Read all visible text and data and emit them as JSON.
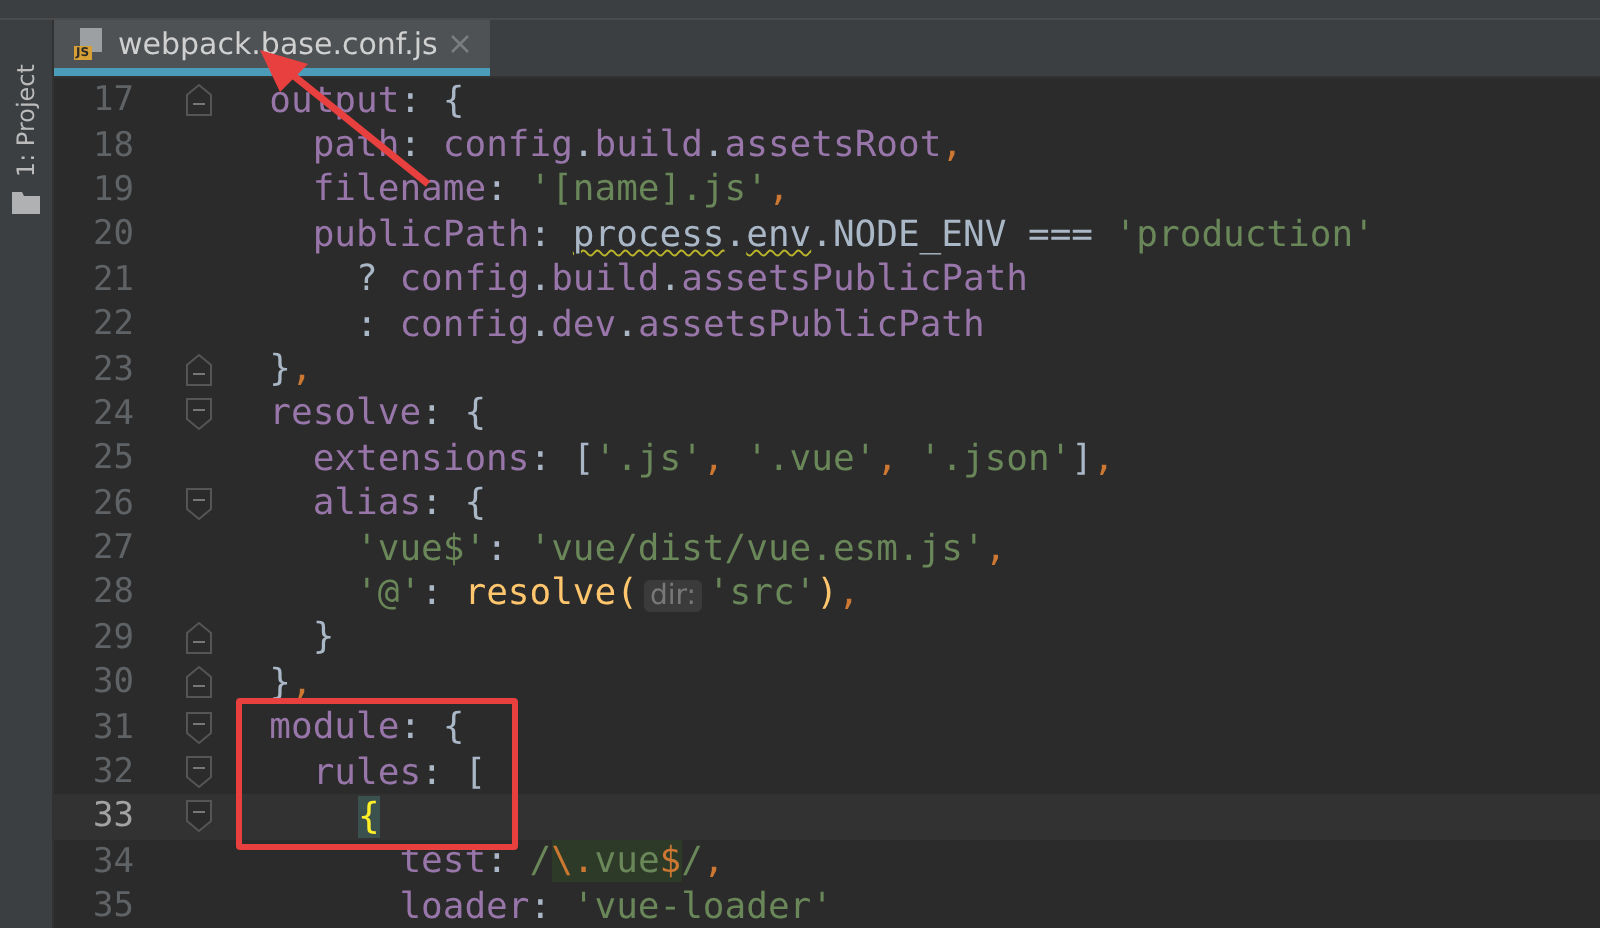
{
  "sidebar": {
    "label": "1: Project"
  },
  "tabs": [
    {
      "label": "webpack.base.conf.js",
      "badge": "JS",
      "selected": true
    }
  ],
  "editor": {
    "lines": [
      {
        "number": "17",
        "fold_open": false,
        "fold_close": true,
        "current": false,
        "tokens": [
          {
            "kind": "key",
            "text": "  output"
          },
          {
            "kind": "plain",
            "text": ": {"
          }
        ]
      },
      {
        "number": "18",
        "fold_open": false,
        "fold_close": false,
        "current": false,
        "tokens": [
          {
            "kind": "key",
            "text": "    path"
          },
          {
            "kind": "plain",
            "text": ": "
          },
          {
            "kind": "key",
            "text": "config"
          },
          {
            "kind": "plain",
            "text": "."
          },
          {
            "kind": "key",
            "text": "build"
          },
          {
            "kind": "plain",
            "text": "."
          },
          {
            "kind": "key",
            "text": "assetsRoot"
          },
          {
            "kind": "comma",
            "text": ","
          }
        ]
      },
      {
        "number": "19",
        "fold_open": false,
        "fold_close": false,
        "current": false,
        "tokens": [
          {
            "kind": "key",
            "text": "    filename"
          },
          {
            "kind": "plain",
            "text": ": "
          },
          {
            "kind": "string",
            "text": "'[name].js'"
          },
          {
            "kind": "comma",
            "text": ","
          }
        ]
      },
      {
        "number": "20",
        "fold_open": false,
        "fold_close": false,
        "current": false,
        "tokens": [
          {
            "kind": "key",
            "text": "    publicPath"
          },
          {
            "kind": "plain",
            "text": ": "
          },
          {
            "kind": "warn",
            "text": "process"
          },
          {
            "kind": "plain",
            "text": "."
          },
          {
            "kind": "warn",
            "text": "env"
          },
          {
            "kind": "plain",
            "text": ".NODE_ENV === "
          },
          {
            "kind": "string",
            "text": "'production'"
          }
        ]
      },
      {
        "number": "21",
        "fold_open": false,
        "fold_close": false,
        "current": false,
        "tokens": [
          {
            "kind": "plain",
            "text": "      ? "
          },
          {
            "kind": "key",
            "text": "config"
          },
          {
            "kind": "plain",
            "text": "."
          },
          {
            "kind": "key",
            "text": "build"
          },
          {
            "kind": "plain",
            "text": "."
          },
          {
            "kind": "key",
            "text": "assetsPublicPath"
          }
        ]
      },
      {
        "number": "22",
        "fold_open": false,
        "fold_close": false,
        "current": false,
        "tokens": [
          {
            "kind": "plain",
            "text": "      : "
          },
          {
            "kind": "key",
            "text": "config"
          },
          {
            "kind": "plain",
            "text": "."
          },
          {
            "kind": "key",
            "text": "dev"
          },
          {
            "kind": "plain",
            "text": "."
          },
          {
            "kind": "key",
            "text": "assetsPublicPath"
          }
        ]
      },
      {
        "number": "23",
        "fold_open": false,
        "fold_close": true,
        "current": false,
        "tokens": [
          {
            "kind": "plain",
            "text": "  }"
          },
          {
            "kind": "comma",
            "text": ","
          }
        ]
      },
      {
        "number": "24",
        "fold_open": true,
        "fold_close": false,
        "current": false,
        "tokens": [
          {
            "kind": "key",
            "text": "  resolve"
          },
          {
            "kind": "plain",
            "text": ": {"
          }
        ]
      },
      {
        "number": "25",
        "fold_open": false,
        "fold_close": false,
        "current": false,
        "tokens": [
          {
            "kind": "key",
            "text": "    extensions"
          },
          {
            "kind": "plain",
            "text": ": ["
          },
          {
            "kind": "string",
            "text": "'.js'"
          },
          {
            "kind": "comma",
            "text": ","
          },
          {
            "kind": "string",
            "text": " '.vue'"
          },
          {
            "kind": "comma",
            "text": ","
          },
          {
            "kind": "string",
            "text": " '.json'"
          },
          {
            "kind": "plain",
            "text": "]"
          },
          {
            "kind": "comma",
            "text": ","
          }
        ]
      },
      {
        "number": "26",
        "fold_open": true,
        "fold_close": false,
        "current": false,
        "tokens": [
          {
            "kind": "key",
            "text": "    alias"
          },
          {
            "kind": "plain",
            "text": ": {"
          }
        ]
      },
      {
        "number": "27",
        "fold_open": false,
        "fold_close": false,
        "current": false,
        "tokens": [
          {
            "kind": "string",
            "text": "      'vue$'"
          },
          {
            "kind": "plain",
            "text": ": "
          },
          {
            "kind": "string",
            "text": "'vue/dist/vue.esm.js'"
          },
          {
            "kind": "comma",
            "text": ","
          }
        ]
      },
      {
        "number": "28",
        "fold_open": false,
        "fold_close": false,
        "current": false,
        "tokens": [
          {
            "kind": "string",
            "text": "      '@'"
          },
          {
            "kind": "plain",
            "text": ": "
          },
          {
            "kind": "call",
            "text": "resolve("
          },
          {
            "kind": "hint",
            "text": "dir:"
          },
          {
            "kind": "string",
            "text": "'src'"
          },
          {
            "kind": "call",
            "text": ")"
          },
          {
            "kind": "comma",
            "text": ","
          }
        ]
      },
      {
        "number": "29",
        "fold_open": false,
        "fold_close": true,
        "current": false,
        "tokens": [
          {
            "kind": "plain",
            "text": "    }"
          }
        ]
      },
      {
        "number": "30",
        "fold_open": false,
        "fold_close": true,
        "current": false,
        "tokens": [
          {
            "kind": "plain",
            "text": "  }"
          },
          {
            "kind": "comma",
            "text": ","
          }
        ]
      },
      {
        "number": "31",
        "fold_open": true,
        "fold_close": false,
        "current": false,
        "tokens": [
          {
            "kind": "key",
            "text": "  module"
          },
          {
            "kind": "plain",
            "text": ": {"
          }
        ]
      },
      {
        "number": "32",
        "fold_open": true,
        "fold_close": false,
        "current": false,
        "tokens": [
          {
            "kind": "key",
            "text": "    rules"
          },
          {
            "kind": "plain",
            "text": ": ["
          }
        ]
      },
      {
        "number": "33",
        "fold_open": true,
        "fold_close": false,
        "current": true,
        "tokens": [
          {
            "kind": "match",
            "text": "{"
          }
        ]
      },
      {
        "number": "34",
        "fold_open": false,
        "fold_close": false,
        "current": false,
        "tokens": [
          {
            "kind": "key",
            "text": "        test"
          },
          {
            "kind": "plain",
            "text": ": "
          },
          {
            "kind": "string",
            "text": "/"
          },
          {
            "kind": "regex",
            "text": "\\."
          },
          {
            "kind": "regexg",
            "text": "vue"
          },
          {
            "kind": "regex",
            "text": "$"
          },
          {
            "kind": "string",
            "text": "/"
          },
          {
            "kind": "comma",
            "text": ","
          }
        ]
      },
      {
        "number": "35",
        "fold_open": false,
        "fold_close": false,
        "current": false,
        "tokens": [
          {
            "kind": "key",
            "text": "        loader"
          },
          {
            "kind": "plain",
            "text": ": "
          },
          {
            "kind": "string",
            "text": "'vue-loader'"
          }
        ]
      }
    ]
  }
}
